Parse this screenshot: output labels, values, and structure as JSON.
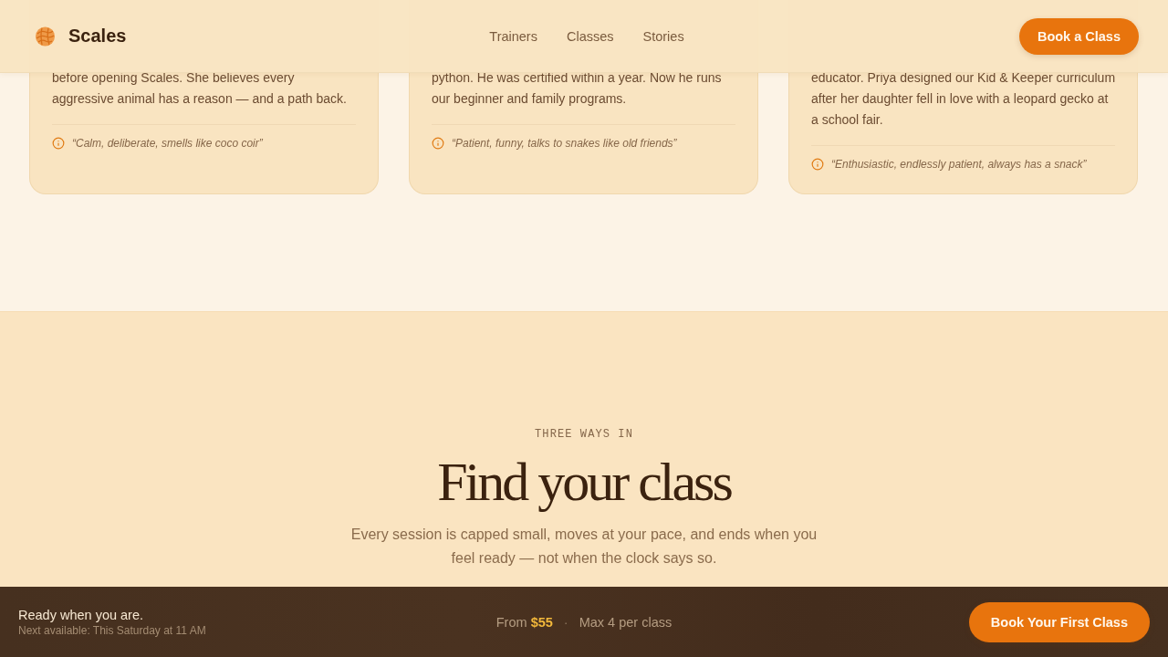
{
  "header": {
    "logo": "Scales",
    "nav": [
      {
        "label": "Trainers"
      },
      {
        "label": "Classes"
      },
      {
        "label": "Stories"
      }
    ],
    "cta": "Book a Class"
  },
  "trainers": [
    {
      "bio": "before opening Scales. She believes every\naggressive animal has a reason — and a path back.",
      "quote": "“Calm, deliberate, smells like coco coir”"
    },
    {
      "bio": "python. He was certified within a year. Now he runs\nour beginner and family programs.",
      "quote": "“Patient, funny, talks to snakes like old friends”"
    },
    {
      "bio": "educator. Priya designed our Kid & Keeper curriculum\nafter her daughter fell in love with a leopard gecko at\na school fair.",
      "quote": "“Enthusiastic, endlessly patient, always has a snack”"
    }
  ],
  "classes_intro": {
    "eyebrow": "THREE WAYS IN",
    "title": "Find your class",
    "subtitle": "Every session is capped small, moves at your pace, and ends when you feel ready — not when the clock says so."
  },
  "booking_bar": {
    "headline": "Ready when you are.",
    "next_available": "Next available: This Saturday at 11 AM",
    "price": "From **$55**",
    "separator": "·",
    "capacity": "Max 4 per class",
    "cta": "Book Your First Class"
  }
}
